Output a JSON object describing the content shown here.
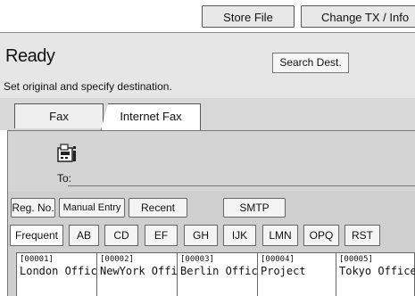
{
  "toolbar": {
    "store_file": "Store File",
    "change_tx": "Change TX / Info"
  },
  "header": {
    "status": "Ready",
    "instruction": "Set original and specify destination.",
    "search_dest": "Search Dest."
  },
  "tabs": {
    "fax": "Fax",
    "internet_fax": "Internet Fax"
  },
  "entry": {
    "to_label": "To:"
  },
  "buttons": {
    "reg_no": "Reg. No.",
    "manual_entry": "Manual Entry",
    "recent": "Recent",
    "smtp": "SMTP"
  },
  "index_tabs": [
    "Frequent",
    "AB",
    "CD",
    "EF",
    "GH",
    "IJK",
    "LMN",
    "OPQ",
    "RST"
  ],
  "destinations": [
    {
      "code": "[00001]",
      "name": "London Office"
    },
    {
      "code": "[00002]",
      "name": "NewYork Office"
    },
    {
      "code": "[00003]",
      "name": "Berlin Office"
    },
    {
      "code": "[00004]",
      "name": "Project"
    },
    {
      "code": "[00005]",
      "name": "Tokyo Office"
    }
  ]
}
